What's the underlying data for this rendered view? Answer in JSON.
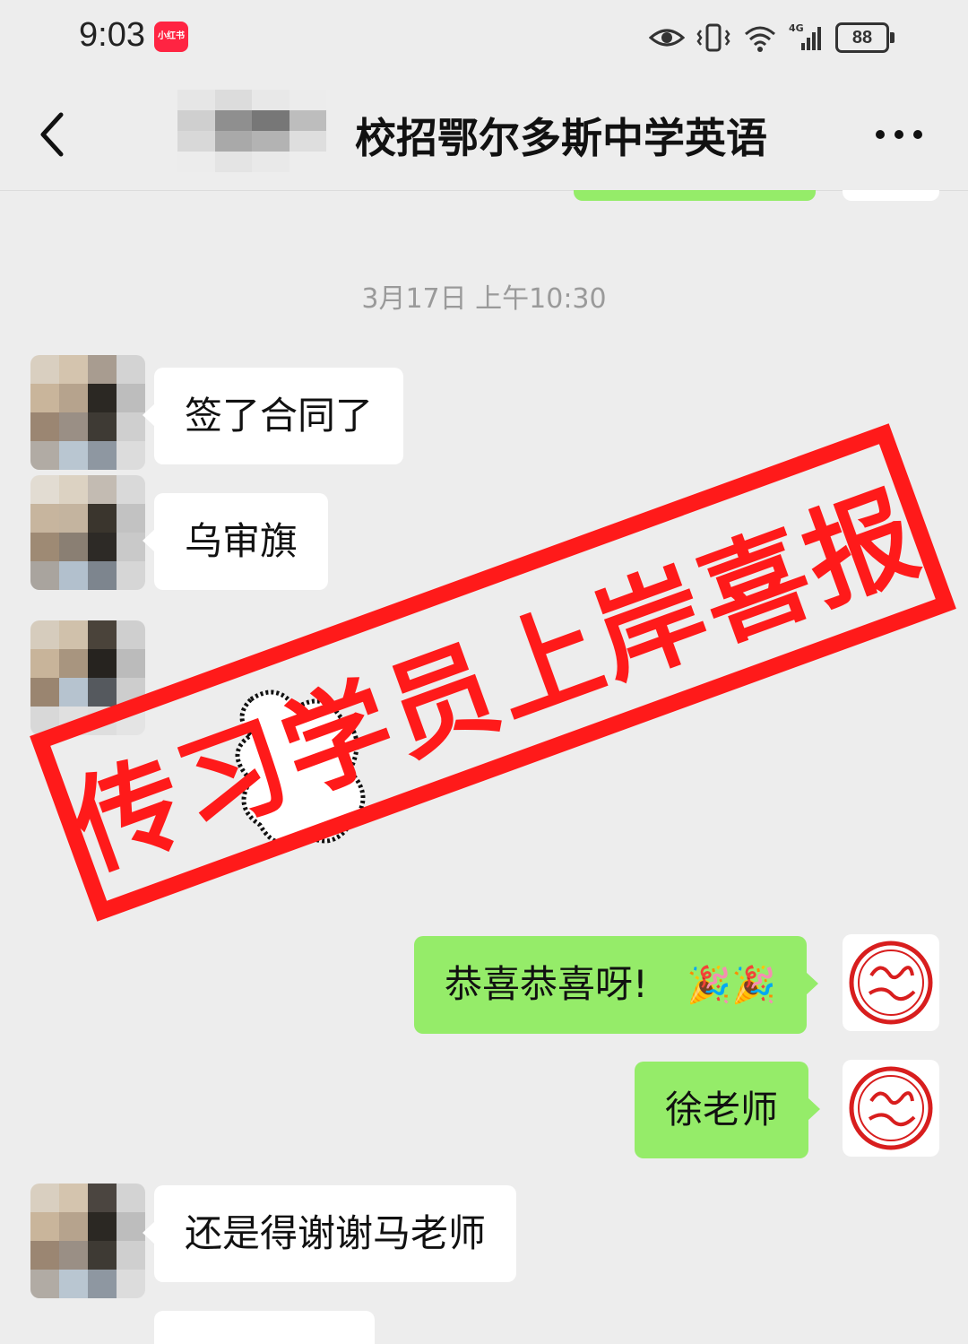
{
  "status_bar": {
    "time": "9:03",
    "app_badge": "小红书",
    "battery": "88"
  },
  "nav": {
    "title": "校招鄂尔多斯中学英语",
    "back_icon": "chevron-left-icon",
    "more_icon": "more-dots-icon"
  },
  "chat": {
    "timestamp": "3月17日 上午10:30",
    "messages": [
      {
        "side": "in",
        "text": "签了合同了"
      },
      {
        "side": "in",
        "text": "乌审旗"
      },
      {
        "side": "out",
        "text": "恭喜恭喜呀!",
        "emoji": "🎉🎉"
      },
      {
        "side": "out",
        "text": "徐老师"
      },
      {
        "side": "in",
        "text": "还是得谢谢马老师"
      }
    ]
  },
  "stamp": {
    "text": "传习学员上岸喜报",
    "color": "#ff1a1a"
  },
  "colors": {
    "background": "#ededed",
    "outgoing_bubble": "#95ec69",
    "incoming_bubble": "#ffffff",
    "avatar_seal": "#d81e1e"
  }
}
